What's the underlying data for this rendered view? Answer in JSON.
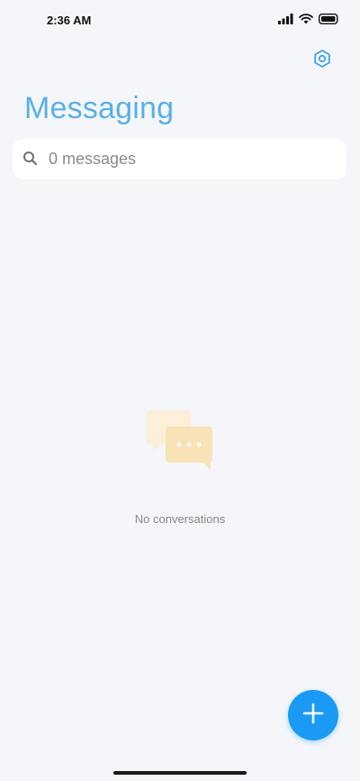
{
  "status_bar": {
    "time": "2:36 AM",
    "icons": [
      "signal-icon",
      "wifi-icon",
      "battery-icon"
    ]
  },
  "header": {
    "title": "Messaging",
    "settings_icon": "settings-hexagon-icon"
  },
  "search": {
    "placeholder": "0 messages",
    "value": ""
  },
  "empty_state": {
    "icon": "chat-bubbles-icon",
    "text": "No conversations"
  },
  "fab": {
    "icon": "plus-icon"
  },
  "colors": {
    "accent": "#1a9af5",
    "title": "#5ab0e6",
    "background": "#f4f6fa"
  }
}
